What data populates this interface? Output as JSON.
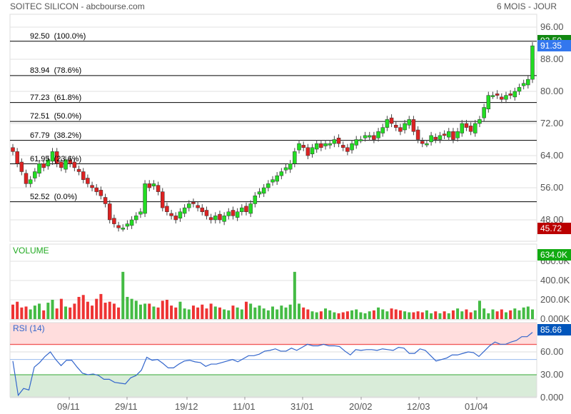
{
  "header": {
    "title": "SOITEC SILICON - abcbourse.com",
    "period": "6 MOIS - JOUR"
  },
  "price_axis": {
    "ticks": [
      "96.00",
      "88.00",
      "80.00",
      "72.00",
      "64.00",
      "56.00",
      "48.00"
    ],
    "tick_values": [
      96,
      88,
      80,
      72,
      64,
      56,
      48
    ],
    "last": "91.35",
    "high_label": "92.50",
    "low_label": "45.72"
  },
  "fibonacci": [
    {
      "label": "92.50  (100.0%)",
      "value": 92.5
    },
    {
      "label": "83.94  (78.6%)",
      "value": 83.94
    },
    {
      "label": "77.23  (61.8%)",
      "value": 77.23
    },
    {
      "label": "72.51  (50.0%)",
      "value": 72.51
    },
    {
      "label": "67.79  (38.2%)",
      "value": 67.79
    },
    {
      "label": "61.95  (23.6%)",
      "value": 61.95
    },
    {
      "label": "52.52  (0.0%)",
      "value": 52.52
    }
  ],
  "volume": {
    "title": "VOLUME",
    "ticks": [
      "600.0K",
      "400.0K",
      "200.0K",
      "0.000K"
    ],
    "last": "634.0K"
  },
  "rsi": {
    "title": "RSI (14)",
    "ticks": [
      "60.00",
      "30.00",
      "0.000"
    ],
    "last": "85.66"
  },
  "x_labels": [
    "09/11",
    "29/11",
    "19/12",
    "11/01",
    "31/01",
    "20/02",
    "12/03",
    "01/04"
  ],
  "colors": {
    "up": "#22dd22",
    "down": "#dd2222",
    "rsi_line": "#3366cc"
  },
  "closes": [
    65,
    62,
    60,
    57,
    58,
    60,
    62,
    61,
    63,
    65,
    62,
    61,
    63,
    62,
    61,
    60,
    58,
    57,
    56,
    55,
    54,
    52,
    48,
    47,
    46,
    46,
    47,
    48,
    49,
    50,
    57,
    56,
    57,
    55,
    51,
    50,
    49,
    48,
    50,
    51,
    52,
    52,
    51,
    50,
    49,
    48,
    49,
    48,
    49,
    50,
    49,
    50,
    51,
    50,
    52,
    54,
    55,
    56,
    57,
    58,
    59,
    60,
    61,
    62,
    65,
    67,
    66,
    64,
    66,
    67,
    66,
    67,
    67,
    68,
    67,
    66,
    65,
    67,
    68,
    68,
    69,
    69,
    68,
    70,
    71,
    73,
    72,
    71,
    70,
    72,
    73,
    70,
    68,
    67,
    67,
    69,
    68,
    69,
    69,
    70,
    68,
    70,
    72,
    71,
    70,
    72,
    73,
    76,
    79,
    79,
    79,
    78,
    79,
    79,
    80,
    81,
    82,
    83,
    91.35
  ],
  "volumes": [
    150,
    180,
    120,
    130,
    100,
    140,
    160,
    90,
    170,
    200,
    110,
    210,
    130,
    120,
    160,
    230,
    250,
    180,
    140,
    210,
    260,
    170,
    180,
    160,
    120,
    490,
    230,
    210,
    190,
    150,
    160,
    160,
    130,
    120,
    190,
    200,
    140,
    120,
    180,
    110,
    100,
    140,
    120,
    150,
    110,
    160,
    130,
    120,
    100,
    90,
    140,
    120,
    100,
    180,
    160,
    120,
    140,
    110,
    90,
    130,
    100,
    140,
    120,
    150,
    490,
    160,
    120,
    100,
    80,
    70,
    80,
    110,
    90,
    70,
    60,
    70,
    80,
    90,
    100,
    70,
    60,
    80,
    90,
    120,
    100,
    80,
    110,
    100,
    90,
    80,
    70,
    70,
    80,
    70,
    90,
    60,
    80,
    60,
    80,
    60,
    90,
    110,
    80,
    100,
    70,
    90,
    190,
    110,
    60,
    100,
    80,
    100,
    70,
    90,
    110,
    90,
    120,
    130,
    100,
    160,
    634
  ],
  "rsi_values": [
    48,
    3,
    12,
    10,
    40,
    46,
    54,
    60,
    50,
    42,
    49,
    49,
    40,
    32,
    30,
    31,
    29,
    24,
    24,
    20,
    19,
    18,
    26,
    29,
    36,
    53,
    49,
    50,
    45,
    39,
    39,
    44,
    48,
    49,
    47,
    46,
    41,
    44,
    44,
    46,
    48,
    50,
    47,
    51,
    55,
    55,
    57,
    61,
    62,
    64,
    61,
    61,
    65,
    62,
    66,
    70,
    68,
    68,
    70,
    68,
    68,
    67,
    61,
    56,
    63,
    62,
    63,
    63,
    62,
    64,
    63,
    62,
    66,
    65,
    58,
    58,
    64,
    62,
    55,
    48,
    50,
    52,
    56,
    56,
    58,
    60,
    59,
    54,
    61,
    68,
    73,
    70,
    70,
    73,
    75,
    80,
    80,
    85.66
  ]
}
